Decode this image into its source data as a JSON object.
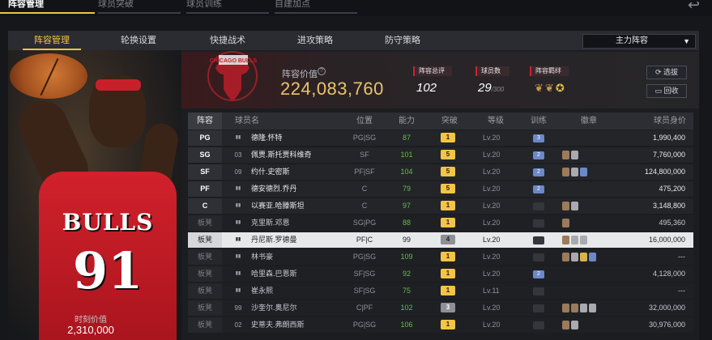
{
  "top_tabs": [
    {
      "label": "阵容管理",
      "active": true
    },
    {
      "label": "球员突破",
      "active": false
    },
    {
      "label": "球员训练",
      "active": false
    },
    {
      "label": "自建加点",
      "active": false
    }
  ],
  "sub_tabs": [
    {
      "label": "阵容管理",
      "active": true
    },
    {
      "label": "轮换设置",
      "active": false
    },
    {
      "label": "快捷战术",
      "active": false
    },
    {
      "label": "进攻策略",
      "active": false
    },
    {
      "label": "防守策略",
      "active": false
    }
  ],
  "lineup_dropdown": {
    "selected": "主力阵容"
  },
  "featured_player": {
    "jersey_team": "BULLS",
    "jersey_number": "91",
    "price_label": "时刻价值",
    "price": "2,310,000"
  },
  "team": {
    "logo_text": "CHICAGO BULLS",
    "value_label": "阵容价值",
    "value": "224,083,760",
    "rating_label": "阵容总评",
    "rating": "102",
    "count_label": "球员数",
    "count": "29",
    "count_max": "/300",
    "bond_label": "阵容羁绊"
  },
  "buttons": {
    "select": "选拔",
    "recycle": "回收"
  },
  "table": {
    "headers": [
      "阵容",
      "球员名",
      "位置",
      "能力",
      "突破",
      "等级",
      "训练",
      "徽章",
      "球员身价"
    ],
    "rows": [
      {
        "slot": "PG",
        "num": "",
        "name": "德隆.怀特",
        "pos": "PG|SG",
        "ability": "87",
        "break": "1",
        "level": "Lv.20",
        "train": "3",
        "badges": [],
        "salary": "1,990,400",
        "type": "starter"
      },
      {
        "slot": "SG",
        "num": "03",
        "name": "佩贾.斯托贾科维奇",
        "pos": "SF",
        "ability": "101",
        "break": "5",
        "level": "Lv.20",
        "train": "2",
        "badges": [
          "bronze",
          "silver"
        ],
        "salary": "7,760,000",
        "type": "starter"
      },
      {
        "slot": "SF",
        "num": "09",
        "name": "约什.史密斯",
        "pos": "PF|SF",
        "ability": "104",
        "break": "5",
        "level": "Lv.20",
        "train": "2",
        "badges": [
          "bronze",
          "silver",
          "blue"
        ],
        "salary": "124,800,000",
        "type": "starter"
      },
      {
        "slot": "PF",
        "num": "",
        "name": "德安德烈.乔丹",
        "pos": "C",
        "ability": "79",
        "break": "5",
        "level": "Lv.20",
        "train": "2",
        "badges": [],
        "salary": "475,200",
        "type": "starter"
      },
      {
        "slot": "C",
        "num": "",
        "name": "以赛亚.哈滕斯坦",
        "pos": "C",
        "ability": "97",
        "break": "1",
        "level": "Lv.20",
        "train": "",
        "badges": [
          "bronze",
          "silver"
        ],
        "salary": "3,148,800",
        "type": "starter"
      },
      {
        "slot": "板凳",
        "num": "",
        "name": "克里斯.邓恩",
        "pos": "SG|PG",
        "ability": "88",
        "break": "1",
        "level": "Lv.20",
        "train": "",
        "badges": [
          "bronze"
        ],
        "salary": "495,360",
        "type": "bench"
      },
      {
        "slot": "板凳",
        "num": "",
        "name": "丹尼斯.罗德曼",
        "pos": "PF|C",
        "ability": "99",
        "break": "4",
        "level": "Lv.20",
        "train": "",
        "badges": [
          "bronze",
          "silver",
          "silver"
        ],
        "salary": "16,000,000",
        "type": "selected"
      },
      {
        "slot": "板凳",
        "num": "",
        "name": "林书豪",
        "pos": "PG|SG",
        "ability": "109",
        "break": "1",
        "level": "Lv.20",
        "train": "",
        "badges": [
          "bronze",
          "silver",
          "gold",
          "blue"
        ],
        "salary": "---",
        "type": "bench"
      },
      {
        "slot": "板凳",
        "num": "",
        "name": "哈里森.巴恩斯",
        "pos": "SF|SG",
        "ability": "92",
        "break": "1",
        "level": "Lv.20",
        "train": "2",
        "badges": [],
        "salary": "4,128,000",
        "type": "bench"
      },
      {
        "slot": "板凳",
        "num": "",
        "name": "崔永熙",
        "pos": "SF|SG",
        "ability": "75",
        "break": "1",
        "level": "Lv.11",
        "train": "",
        "badges": [],
        "salary": "---",
        "type": "bench"
      },
      {
        "slot": "板凳",
        "num": "99",
        "name": "沙奎尔.奥尼尔",
        "pos": "C|PF",
        "ability": "102",
        "break": "3",
        "level": "Lv.20",
        "train": "",
        "badges": [
          "bronze",
          "bronze",
          "silver",
          "silver"
        ],
        "salary": "32,000,000",
        "type": "bench"
      },
      {
        "slot": "板凳",
        "num": "02",
        "name": "史蒂夫.弗朗西斯",
        "pos": "PG|SG",
        "ability": "106",
        "break": "1",
        "level": "Lv.20",
        "train": "",
        "badges": [
          "bronze",
          "silver"
        ],
        "salary": "30,976,000",
        "type": "bench"
      }
    ]
  }
}
